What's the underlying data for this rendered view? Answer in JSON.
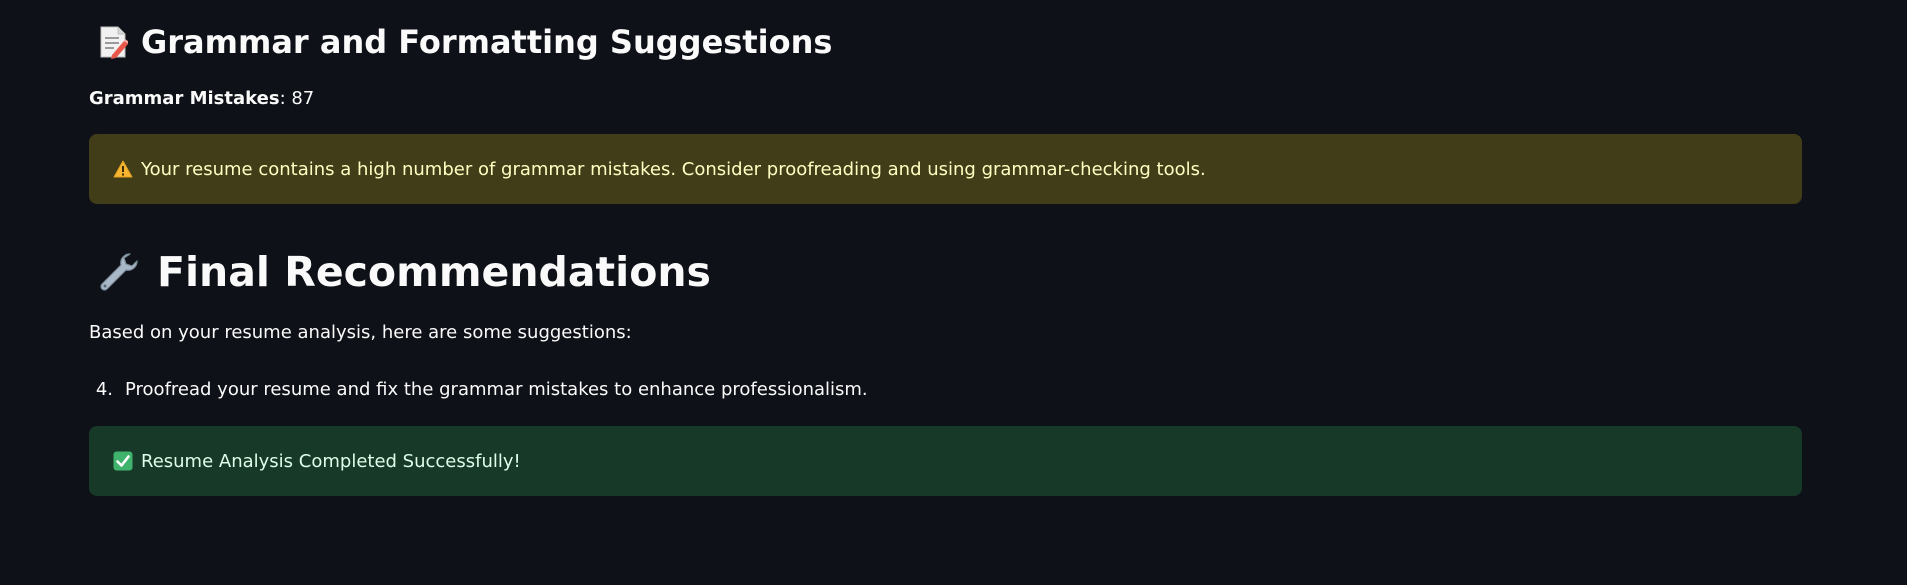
{
  "grammar_section": {
    "title": "Grammar and Formatting Suggestions",
    "icon": "memo-icon",
    "mistakes_label": "Grammar Mistakes",
    "mistakes_value": ": 87",
    "warning_icon": "warning-icon",
    "warning_text": "Your resume contains a high number of grammar mistakes. Consider proofreading and using grammar-checking tools."
  },
  "recommendations_section": {
    "title": "Final Recommendations",
    "icon": "wrench-icon",
    "intro": "Based on your resume analysis, here are some suggestions:",
    "items": [
      {
        "number": "4.",
        "text": "Proofread your resume and fix the grammar mistakes to enhance professionalism."
      }
    ]
  },
  "success_alert": {
    "icon": "check-mark-icon",
    "text": "Resume Analysis Completed Successfully!"
  },
  "colors": {
    "background": "#0e1117",
    "warning_bg": "#413d18",
    "warning_text": "#ffffc2",
    "success_bg": "#173928",
    "success_text": "#dffde9"
  }
}
